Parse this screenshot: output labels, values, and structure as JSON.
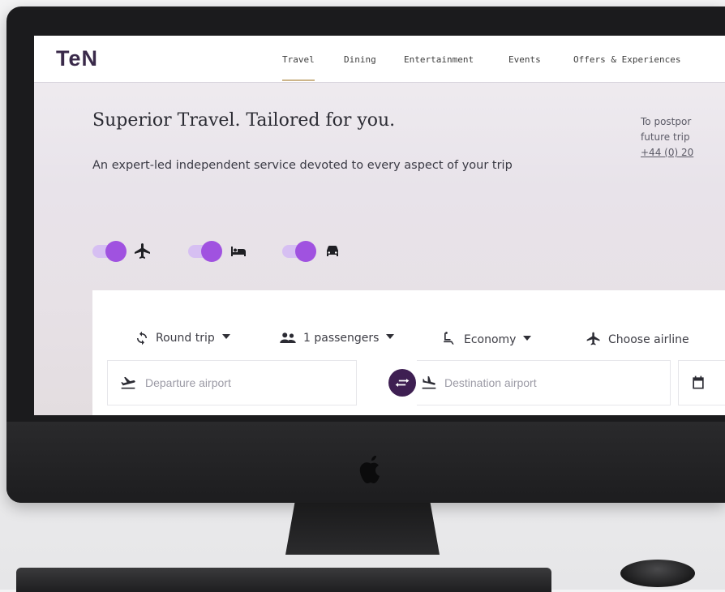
{
  "brand": {
    "logo": "TeN",
    "accent": "#a052e0",
    "dark": "#3e1f52"
  },
  "nav": {
    "items": [
      {
        "label": "Travel",
        "active": true
      },
      {
        "label": "Dining",
        "active": false
      },
      {
        "label": "Entertainment",
        "active": false
      },
      {
        "label": "Events",
        "active": false
      },
      {
        "label": "Offers & Experiences",
        "active": false
      }
    ]
  },
  "hero": {
    "title": "Superior Travel. Tailored for you.",
    "subtitle": "An expert-led independent service devoted to every aspect of your trip"
  },
  "side_note": {
    "line1": "To postpor",
    "line2": "future trip",
    "phone": "+44 (0) 20"
  },
  "toggles": [
    {
      "name": "flights",
      "icon": "airplane-icon",
      "on": true
    },
    {
      "name": "hotels",
      "icon": "bed-icon",
      "on": true
    },
    {
      "name": "cars",
      "icon": "car-icon",
      "on": true
    }
  ],
  "search": {
    "trip_type": "Round trip",
    "passengers": "1 passengers",
    "cabin": "Economy",
    "airline": "Choose airline",
    "departure_placeholder": "Departure airport",
    "destination_placeholder": "Destination airport"
  }
}
